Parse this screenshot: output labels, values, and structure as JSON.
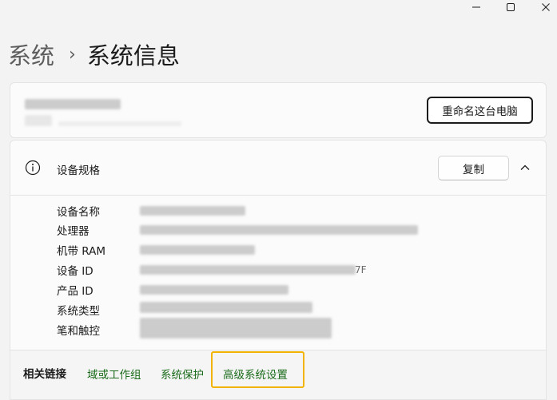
{
  "window": {
    "minimize_icon": "minimize-icon",
    "maximize_icon": "maximize-icon",
    "close_icon": "close-icon"
  },
  "breadcrumb": {
    "parent": "系统",
    "separator": "›",
    "current": "系统信息"
  },
  "device_card": {
    "rename_button": "重命名这台电脑"
  },
  "specs": {
    "icon": "info-icon",
    "title": "设备规格",
    "copy_button": "复制",
    "collapse_icon": "chevron-up-icon",
    "rows": [
      {
        "label": "设备名称"
      },
      {
        "label": "处理器"
      },
      {
        "label": "机带 RAM"
      },
      {
        "label": "设备 ID",
        "visible_tail": "7F"
      },
      {
        "label": "产品 ID"
      },
      {
        "label": "系统类型"
      },
      {
        "label": "笔和触控"
      }
    ]
  },
  "related": {
    "title": "相关链接",
    "links": [
      "域或工作组",
      "系统保护",
      "高级系统设置"
    ]
  },
  "colors": {
    "background": "#f3f3f3",
    "card": "#fbfbfb",
    "link": "#1a6b1a",
    "highlight": "#f2b400"
  }
}
